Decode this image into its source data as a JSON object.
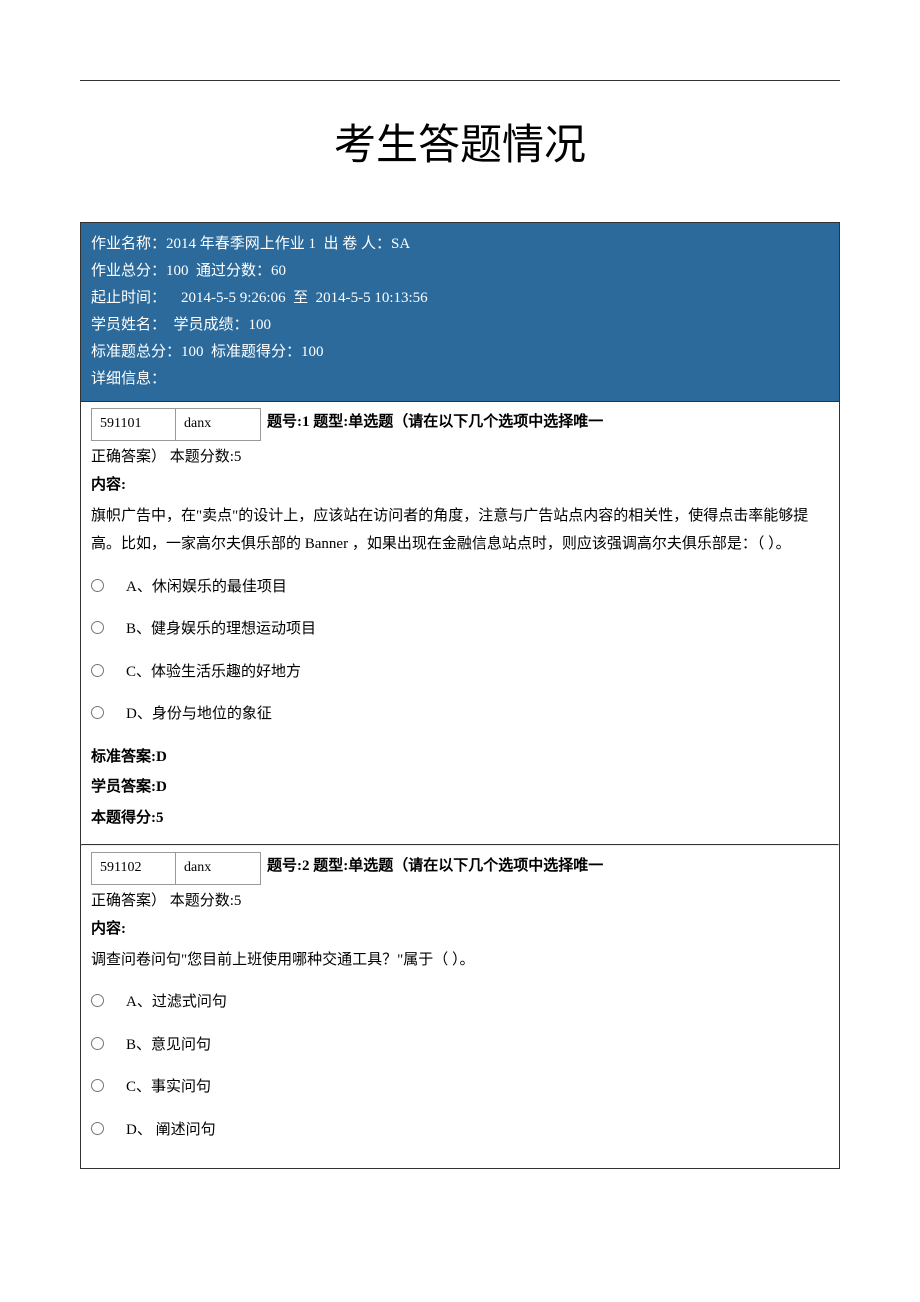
{
  "title": "考生答题情况",
  "header": {
    "line1": "作业名称：2014 年春季网上作业 1  出 卷 人：SA",
    "line2": "作业总分：100  通过分数：60",
    "line3": "起止时间：    2014-5-5 9:26:06  至  2014-5-5 10:13:56",
    "line4": "学员姓名：  学员成绩：100",
    "line5": "标准题总分：100  标准题得分：100",
    "line6": "详细信息："
  },
  "questions": [
    {
      "id": "591101",
      "code": "danx",
      "meta_label": "题号:1  题型:单选题（请在以下几个选项中选择唯一",
      "meta_label2": "正确答案）  本题分数:5",
      "content_label": "内容:",
      "content": "旗帜广告中，在\"卖点\"的设计上，应该站在访问者的角度，注意与广告站点内容的相关性，使得点击率能够提高。比如，一家高尔夫俱乐部的 Banner ，如果出现在金融信息站点时，则应该强调高尔夫俱乐部是：（  ）。",
      "options": [
        "A、休闲娱乐的最佳项目",
        "B、健身娱乐的理想运动项目",
        "C、体验生活乐趣的好地方",
        "D、身份与地位的象征"
      ],
      "standard_answer_label": "标准答案:D",
      "student_answer_label": "学员答案:D",
      "score_label": "本题得分:5"
    },
    {
      "id": "591102",
      "code": "danx",
      "meta_label": "题号:2  题型:单选题（请在以下几个选项中选择唯一",
      "meta_label2": "正确答案）  本题分数:5",
      "content_label": "内容:",
      "content": "调查问卷问句\"您目前上班使用哪种交通工具？\"属于（  ）。",
      "options": [
        "A、过滤式问句",
        "B、意见问句",
        "C、事实问句",
        "D、 阐述问句"
      ],
      "standard_answer_label": "",
      "student_answer_label": "",
      "score_label": ""
    }
  ]
}
